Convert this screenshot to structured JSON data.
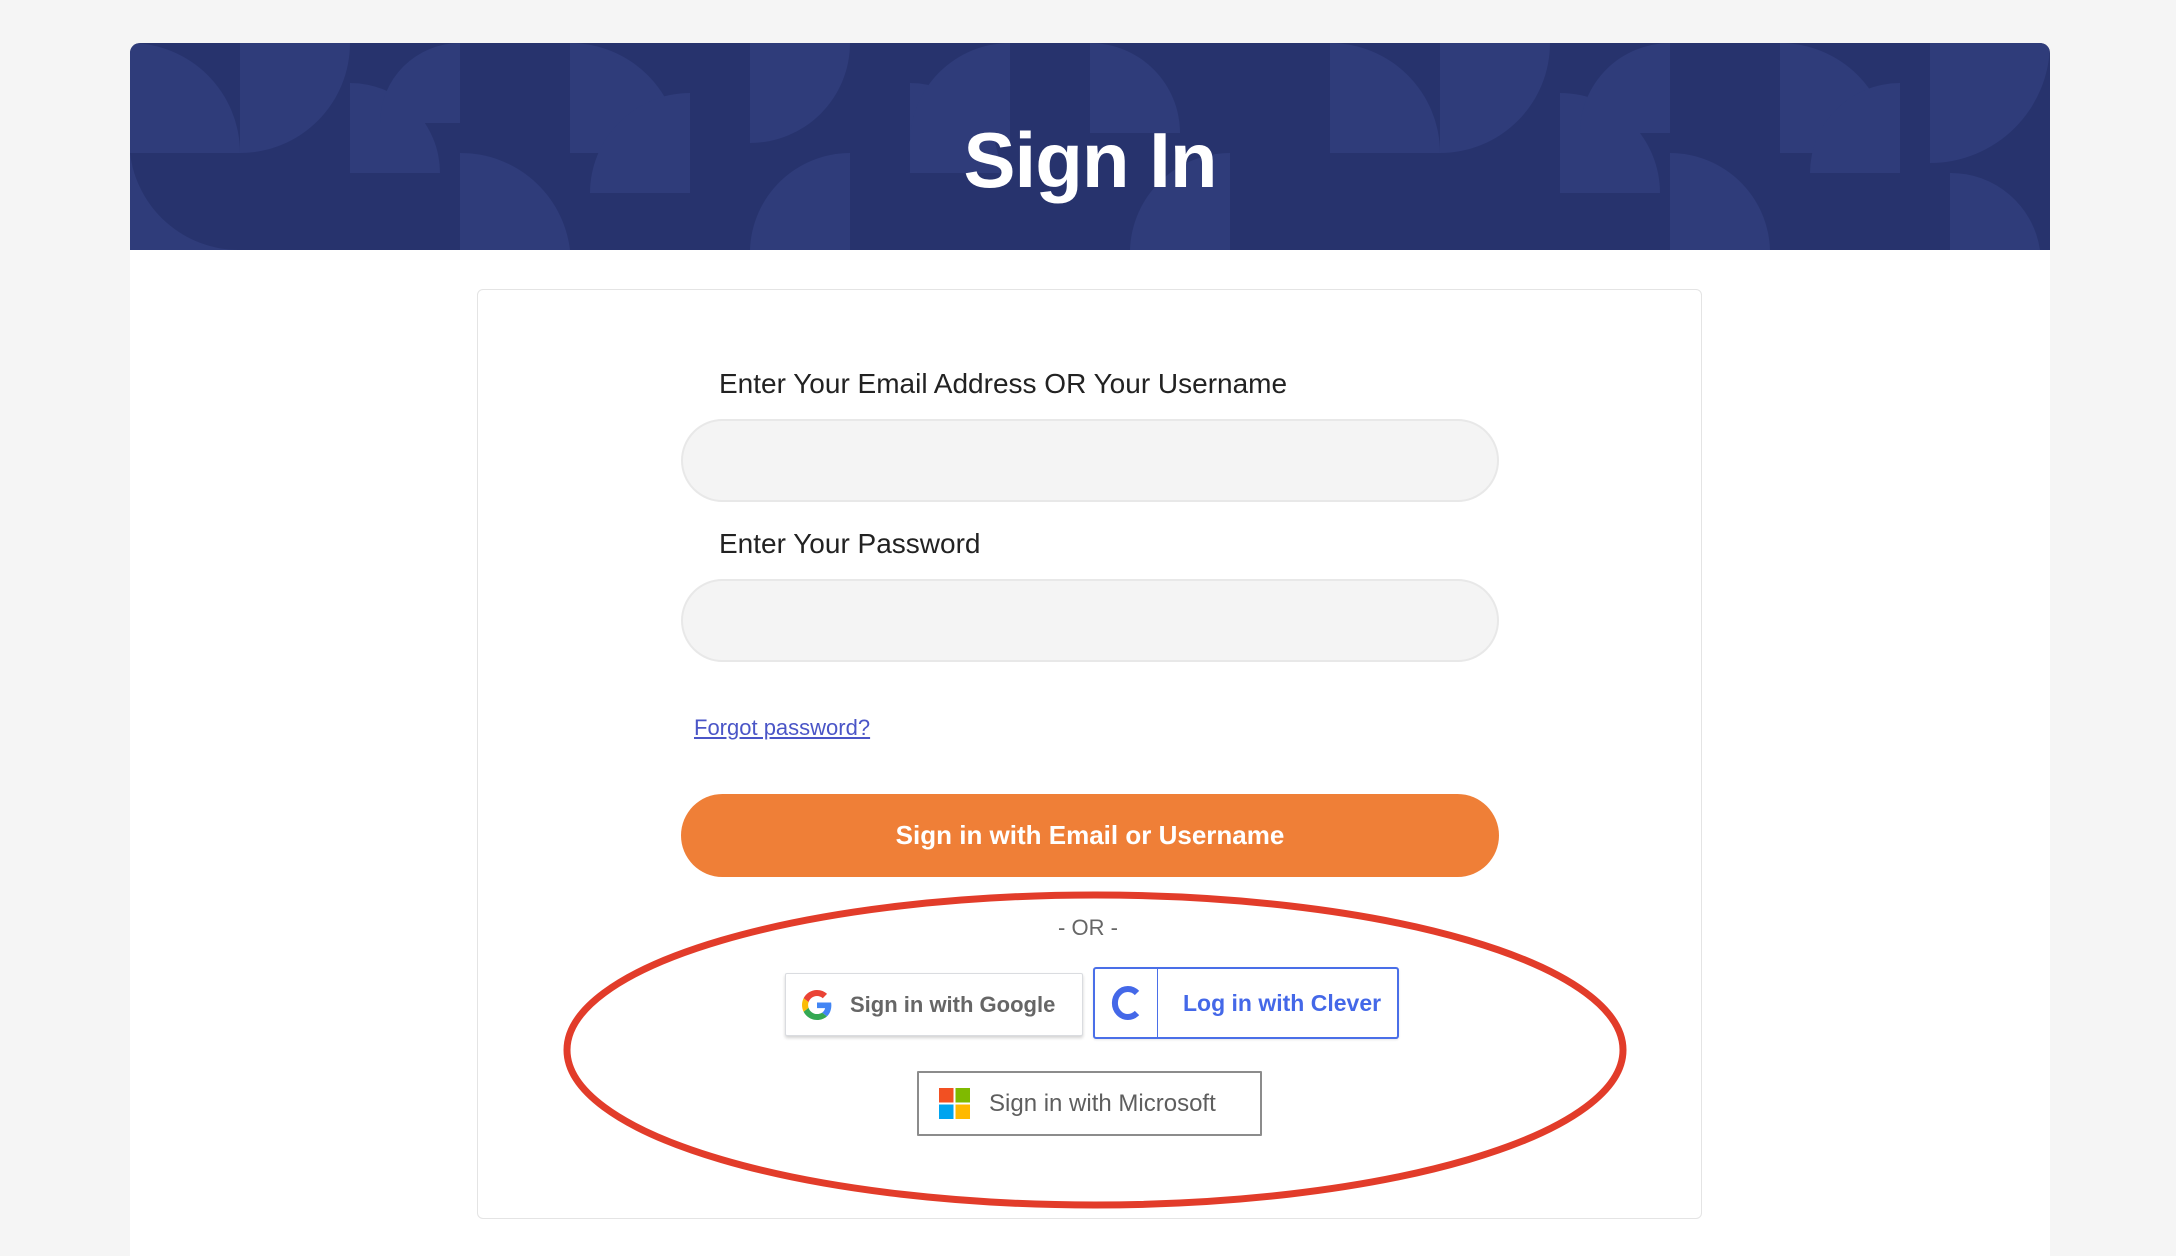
{
  "banner": {
    "title": "Sign In"
  },
  "form": {
    "email_label": "Enter Your Email Address OR Your Username",
    "email_value": "",
    "email_placeholder": "",
    "password_label": "Enter Your Password",
    "password_value": "",
    "password_placeholder": "",
    "forgot_link": "Forgot password?",
    "submit_label": "Sign in with Email or Username"
  },
  "divider": {
    "text": "- OR -"
  },
  "sso": {
    "google_label": "Sign in with Google",
    "google_icon": "google-g-icon",
    "clever_label": "Log in with Clever",
    "clever_icon": "clever-c-icon",
    "microsoft_label": "Sign in with Microsoft",
    "microsoft_icon": "microsoft-logo-icon"
  },
  "colors": {
    "banner_bg": "#27336d",
    "primary_button": "#ef7f37",
    "link": "#4a55c7",
    "clever_blue": "#4468e8",
    "annotation_red": "#e23c2a"
  }
}
